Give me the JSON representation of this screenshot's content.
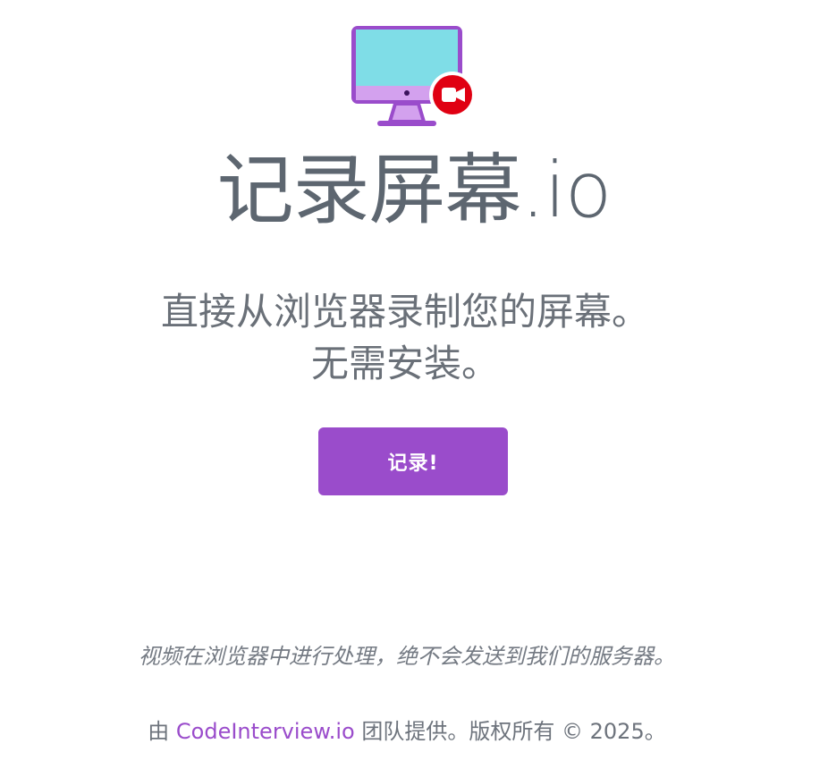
{
  "app": {
    "title": "记录屏幕.io"
  },
  "hero": {
    "subtitle_line1": "直接从浏览器录制您的屏幕。",
    "subtitle_line2": "无需安装。",
    "record_button_label": "记录!"
  },
  "notice": {
    "text": "视频在浏览器中进行处理，绝不会发送到我们的服务器。"
  },
  "footer": {
    "prefix": "由",
    "link_text": "CodeInterview.io",
    "suffix": "团队提供。版权所有 © 2025。"
  },
  "icons": {
    "logo": "monitor-recording-icon",
    "record": "video-camera-icon"
  },
  "colors": {
    "accent": "#9a4ccb",
    "logo_screen": "#7fdde7",
    "logo_frame": "#9a4ccb",
    "logo_stand": "#d3a1ee",
    "record_badge": "#e00012"
  }
}
